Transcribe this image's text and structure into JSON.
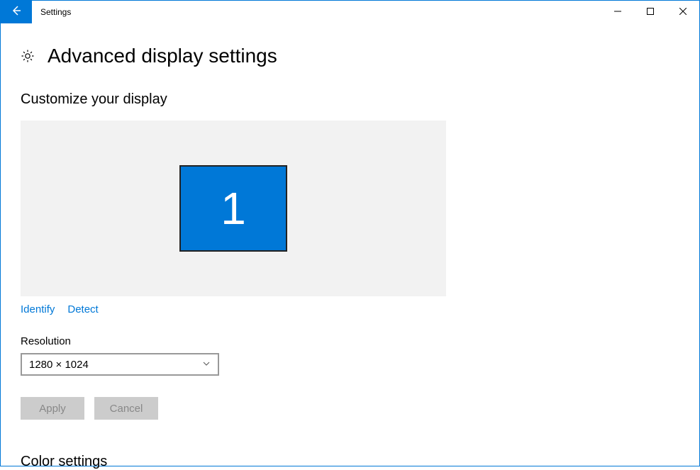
{
  "titlebar": {
    "app_title": "Settings"
  },
  "page": {
    "title": "Advanced display settings"
  },
  "customize": {
    "heading": "Customize your display",
    "monitor_number": "1",
    "identify_link": "Identify",
    "detect_link": "Detect"
  },
  "resolution": {
    "label": "Resolution",
    "selected": "1280 × 1024"
  },
  "buttons": {
    "apply": "Apply",
    "cancel": "Cancel"
  },
  "color_settings": {
    "heading": "Color settings"
  }
}
